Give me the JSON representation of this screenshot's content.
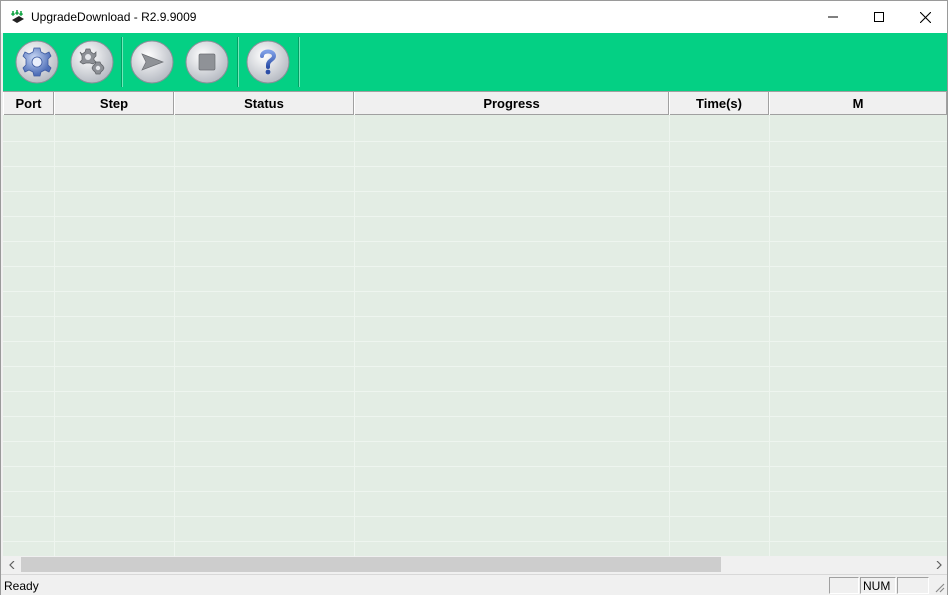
{
  "window": {
    "title": "UpgradeDownload - R2.9.9009"
  },
  "toolbar": {
    "buttons": [
      {
        "name": "settings",
        "icon": "gear-icon"
      },
      {
        "name": "advanced-settings",
        "icon": "double-gear-icon"
      },
      {
        "name": "start",
        "icon": "play-arrow-icon"
      },
      {
        "name": "stop",
        "icon": "stop-square-icon"
      },
      {
        "name": "help",
        "icon": "question-mark-icon"
      }
    ],
    "accent_color": "#04d084"
  },
  "table": {
    "columns": [
      "Port",
      "Step",
      "Status",
      "Progress",
      "Time(s)",
      "M"
    ],
    "rows": []
  },
  "statusbar": {
    "status": "Ready",
    "indicator_num": "NUM"
  }
}
